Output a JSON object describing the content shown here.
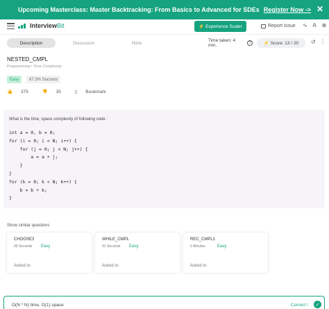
{
  "banner": {
    "message": "Upcoming Masterclass: Master Backtracking: From Basics to Advanced for SDEs",
    "link": "Register Now ->",
    "close": "✕"
  },
  "header": {
    "logo_bold": "Interview",
    "logo_color": "Bit",
    "experience_button": "Experience Scaler",
    "report_issue": "Report Issue",
    "tool_icons": "∿ A ⊗"
  },
  "tabs": [
    {
      "label": "Description",
      "active": true
    },
    {
      "label": "Discussion",
      "active": false
    },
    {
      "label": "Hints",
      "active": false
    }
  ],
  "status": {
    "time_taken": "Time taken: 4 min.",
    "score": "Score: 13 / 20",
    "reset": "↺",
    "more": "⋮"
  },
  "problem": {
    "title": "NESTED_CMPL",
    "subtitle": "Programming • Time Complexity",
    "difficulty": "Easy",
    "success": "67.3% Success",
    "likes": "375",
    "dislikes": "35",
    "bookmark": "Bookmark"
  },
  "question": {
    "text": "What is the time, space complexity of following code :",
    "code": "int a = 0, b = 0;\nfor (i = 0; i < N; i++) {\n    for (j = 0; j < N; j++) {\n        a = a + j;\n    }\n}\nfor (k = 0; k < N; k++) {\n    b = b + k;\n}"
  },
  "similar": {
    "label": "Show similar questions",
    "asked_in": "Asked in:",
    "items": [
      {
        "name": "CHOOSE3",
        "time": "99 Seconds",
        "difficulty": "Easy"
      },
      {
        "name": "WHILE_CMPL",
        "time": "91 Seconds",
        "difficulty": "Easy"
      },
      {
        "name": "REC_CMPL1",
        "time": "6 Minutes",
        "difficulty": "Easy"
      }
    ]
  },
  "answer": {
    "text": "O(N * N) time, O(1) space",
    "status": "Correct !"
  },
  "colors": {
    "accent": "#16a37f"
  }
}
